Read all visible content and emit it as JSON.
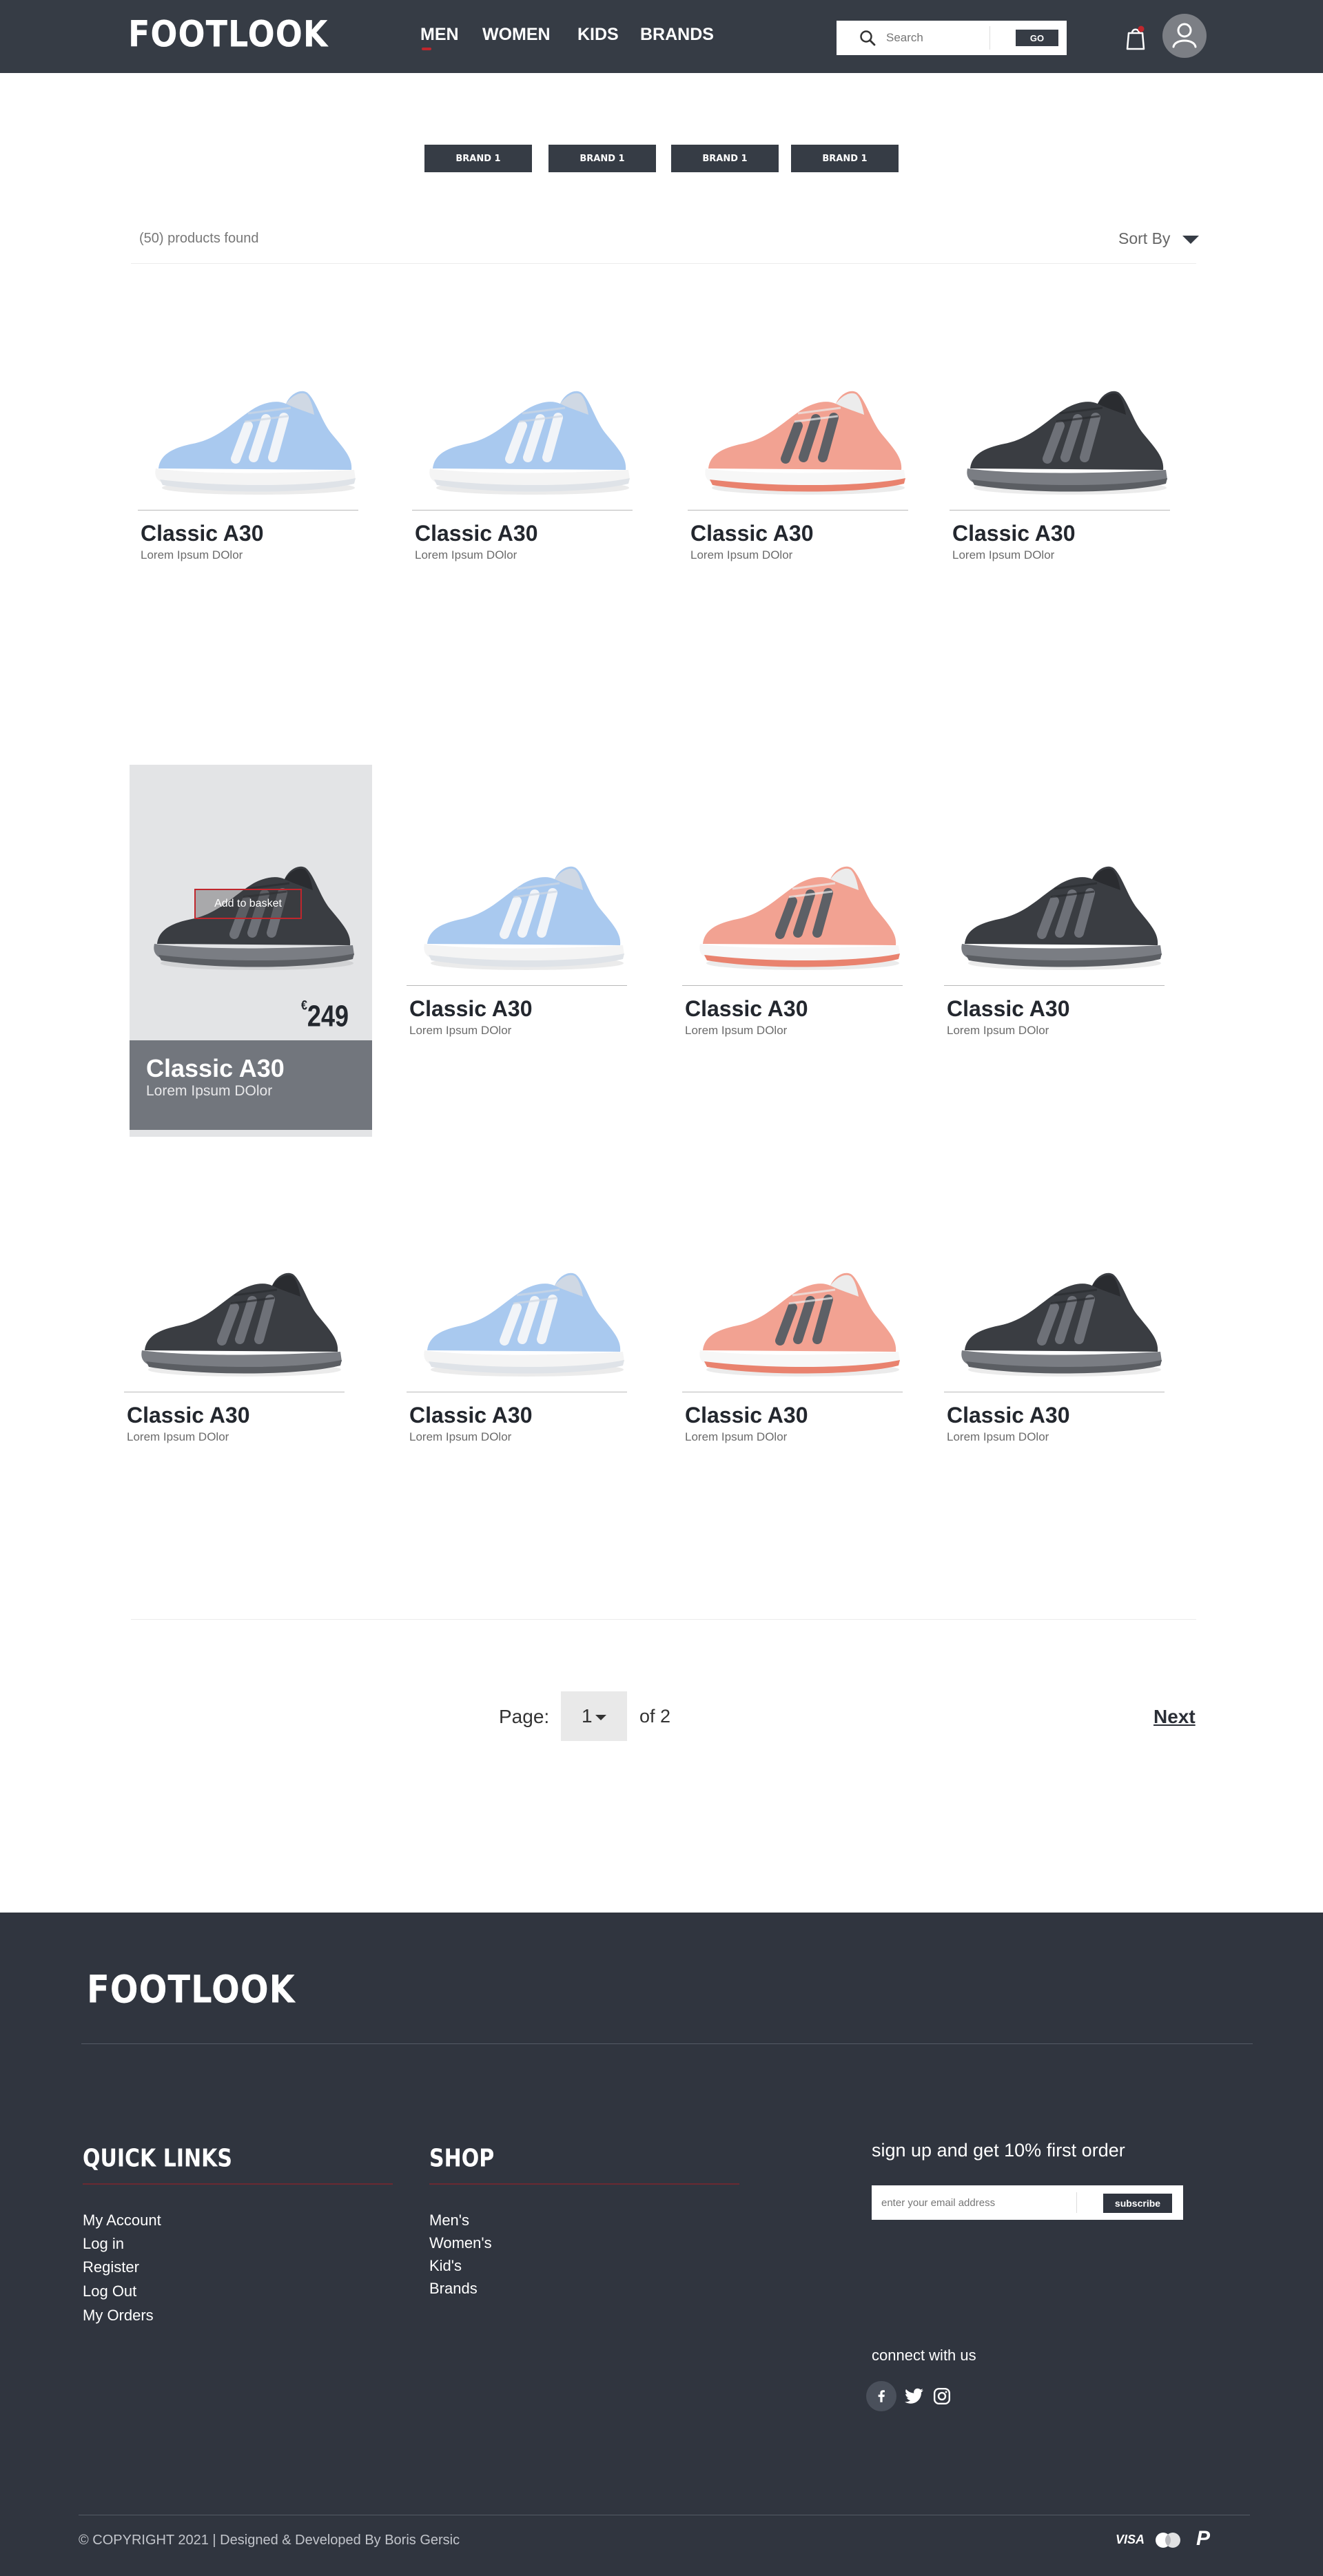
{
  "header": {
    "logo": "FOOTLOOK",
    "nav": [
      "MEN",
      "WOMEN",
      "KIDS",
      "BRANDS"
    ],
    "search_placeholder": "Search",
    "go_label": "GO"
  },
  "brands": [
    "BRAND 1",
    "BRAND 1",
    "BRAND 1",
    "BRAND 1"
  ],
  "toolbar": {
    "found": "(50) products found",
    "sort": "Sort By"
  },
  "products": [
    {
      "name": "Classic A30",
      "subtitle": "Lorem Ipsum DOlor",
      "color": "blue"
    },
    {
      "name": "Classic A30",
      "subtitle": "Lorem Ipsum DOlor",
      "color": "blue"
    },
    {
      "name": "Classic A30",
      "subtitle": "Lorem Ipsum DOlor",
      "color": "pink"
    },
    {
      "name": "Classic A30",
      "subtitle": "Lorem Ipsum DOlor",
      "color": "black"
    },
    {
      "name": "Classic A30",
      "subtitle": "Lorem Ipsum DOlor",
      "color": "black",
      "hover": true,
      "price": "249",
      "currency": "€",
      "basket_label": "Add to basket"
    },
    {
      "name": "Classic A30",
      "subtitle": "Lorem Ipsum DOlor",
      "color": "blue"
    },
    {
      "name": "Classic A30",
      "subtitle": "Lorem Ipsum DOlor",
      "color": "pink"
    },
    {
      "name": "Classic A30",
      "subtitle": "Lorem Ipsum DOlor",
      "color": "black"
    },
    {
      "name": "Classic A30",
      "subtitle": "Lorem Ipsum DOlor",
      "color": "black"
    },
    {
      "name": "Classic A30",
      "subtitle": "Lorem Ipsum DOlor",
      "color": "blue"
    },
    {
      "name": "Classic A30",
      "subtitle": "Lorem Ipsum DOlor",
      "color": "pink"
    },
    {
      "name": "Classic A30",
      "subtitle": "Lorem Ipsum DOlor",
      "color": "black"
    }
  ],
  "pagination": {
    "label": "Page:",
    "current": "1",
    "of": "of 2",
    "next": "Next"
  },
  "footer": {
    "logo": "FOOTLOOK",
    "quick_links_title": "QUICK LINKS",
    "quick_links": [
      "My Account",
      "Log in",
      "Register",
      "Log Out",
      "My Orders"
    ],
    "shop_title": "SHOP",
    "shop_links": [
      "Men's",
      "Women's",
      "Kid's",
      "Brands"
    ],
    "signup_title": "sign up and get 10% first order",
    "email_placeholder": "enter your email address",
    "subscribe_label": "subscribe",
    "connect_title": "connect with us",
    "social": [
      "facebook-icon",
      "twitter-icon",
      "instagram-icon"
    ],
    "copyright": "© COPYRIGHT 2021 | Designed & Developed By Boris Gersic",
    "payments": [
      "VISA",
      "mastercard",
      "P"
    ]
  },
  "colors": {
    "dark": "#363c45",
    "footer": "#30353f",
    "accent": "#c0272d",
    "shoe_blue": "#a9c9ef",
    "shoe_pink": "#f2a292",
    "shoe_black": "#3a3d42"
  }
}
